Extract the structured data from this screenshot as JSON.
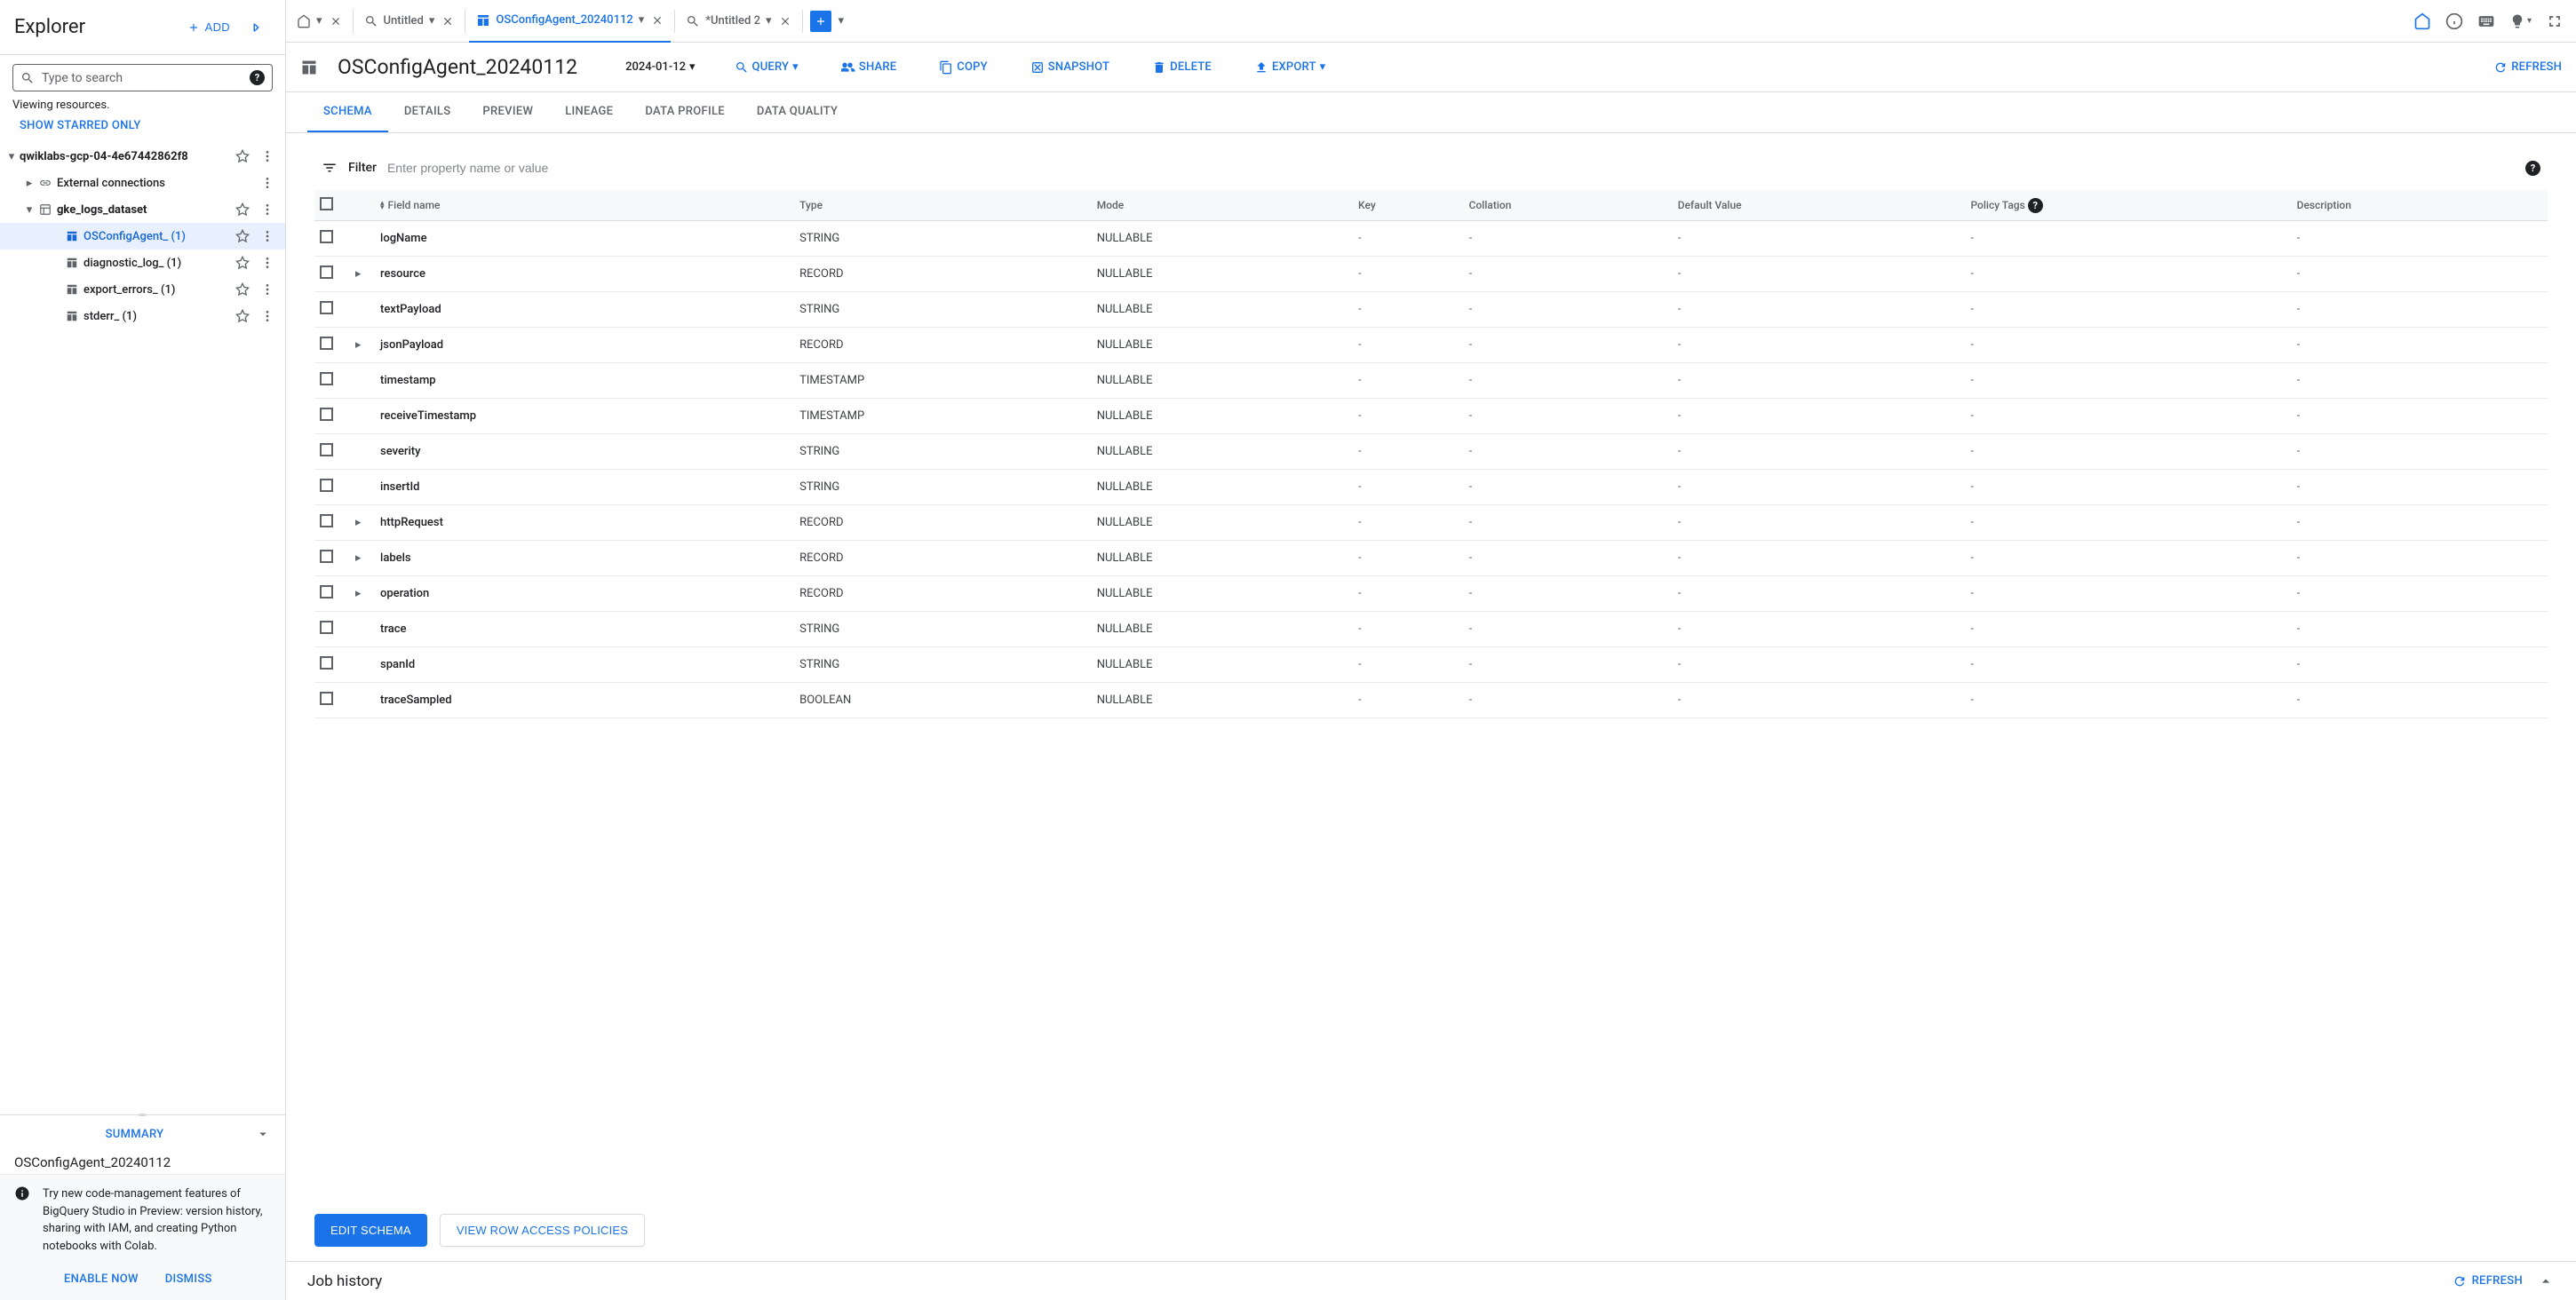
{
  "explorer": {
    "title": "Explorer",
    "add_label": "ADD",
    "search_placeholder": "Type to search",
    "viewing": "Viewing resources.",
    "show_starred": "SHOW STARRED ONLY",
    "tree": {
      "project": "qwiklabs-gcp-04-4e67442862f8",
      "external": "External connections",
      "dataset": "gke_logs_dataset",
      "tables": [
        {
          "name": "OSConfigAgent_ (1)",
          "selected": true
        },
        {
          "name": "diagnostic_log_ (1)",
          "selected": false
        },
        {
          "name": "export_errors_ (1)",
          "selected": false
        },
        {
          "name": "stderr_ (1)",
          "selected": false
        }
      ]
    },
    "summary_label": "SUMMARY",
    "summary_name": "OSConfigAgent_20240112",
    "info": "Try new code-management features of BigQuery Studio in Preview: version history, sharing with IAM, and creating Python notebooks with Colab.",
    "enable": "ENABLE NOW",
    "dismiss": "DISMISS"
  },
  "tabs": [
    {
      "icon": "home",
      "label": "",
      "active": false,
      "closable": true
    },
    {
      "icon": "query",
      "label": "Untitled",
      "active": false,
      "closable": true
    },
    {
      "icon": "table",
      "label": "OSConfigAgent_20240112",
      "active": true,
      "closable": true
    },
    {
      "icon": "query",
      "label": "*Untitled 2",
      "active": false,
      "closable": true
    }
  ],
  "toolbar": {
    "title": "OSConfigAgent_20240112",
    "partition": "2024-01-12",
    "query": "QUERY",
    "share": "SHARE",
    "copy": "COPY",
    "snapshot": "SNAPSHOT",
    "delete": "DELETE",
    "export": "EXPORT",
    "refresh": "REFRESH"
  },
  "subtabs": [
    "SCHEMA",
    "DETAILS",
    "PREVIEW",
    "LINEAGE",
    "DATA PROFILE",
    "DATA QUALITY"
  ],
  "schema": {
    "filter_label": "Filter",
    "filter_placeholder": "Enter property name or value",
    "headers": [
      "Field name",
      "Type",
      "Mode",
      "Key",
      "Collation",
      "Default Value",
      "Policy Tags",
      "Description"
    ],
    "rows": [
      {
        "name": "logName",
        "type": "STRING",
        "mode": "NULLABLE",
        "expandable": false
      },
      {
        "name": "resource",
        "type": "RECORD",
        "mode": "NULLABLE",
        "expandable": true
      },
      {
        "name": "textPayload",
        "type": "STRING",
        "mode": "NULLABLE",
        "expandable": false
      },
      {
        "name": "jsonPayload",
        "type": "RECORD",
        "mode": "NULLABLE",
        "expandable": true
      },
      {
        "name": "timestamp",
        "type": "TIMESTAMP",
        "mode": "NULLABLE",
        "expandable": false
      },
      {
        "name": "receiveTimestamp",
        "type": "TIMESTAMP",
        "mode": "NULLABLE",
        "expandable": false
      },
      {
        "name": "severity",
        "type": "STRING",
        "mode": "NULLABLE",
        "expandable": false
      },
      {
        "name": "insertId",
        "type": "STRING",
        "mode": "NULLABLE",
        "expandable": false
      },
      {
        "name": "httpRequest",
        "type": "RECORD",
        "mode": "NULLABLE",
        "expandable": true
      },
      {
        "name": "labels",
        "type": "RECORD",
        "mode": "NULLABLE",
        "expandable": true
      },
      {
        "name": "operation",
        "type": "RECORD",
        "mode": "NULLABLE",
        "expandable": true
      },
      {
        "name": "trace",
        "type": "STRING",
        "mode": "NULLABLE",
        "expandable": false
      },
      {
        "name": "spanId",
        "type": "STRING",
        "mode": "NULLABLE",
        "expandable": false
      },
      {
        "name": "traceSampled",
        "type": "BOOLEAN",
        "mode": "NULLABLE",
        "expandable": false
      }
    ],
    "edit_btn": "EDIT SCHEMA",
    "view_policies": "VIEW ROW ACCESS POLICIES"
  },
  "jobhistory": {
    "label": "Job history",
    "refresh": "REFRESH"
  }
}
